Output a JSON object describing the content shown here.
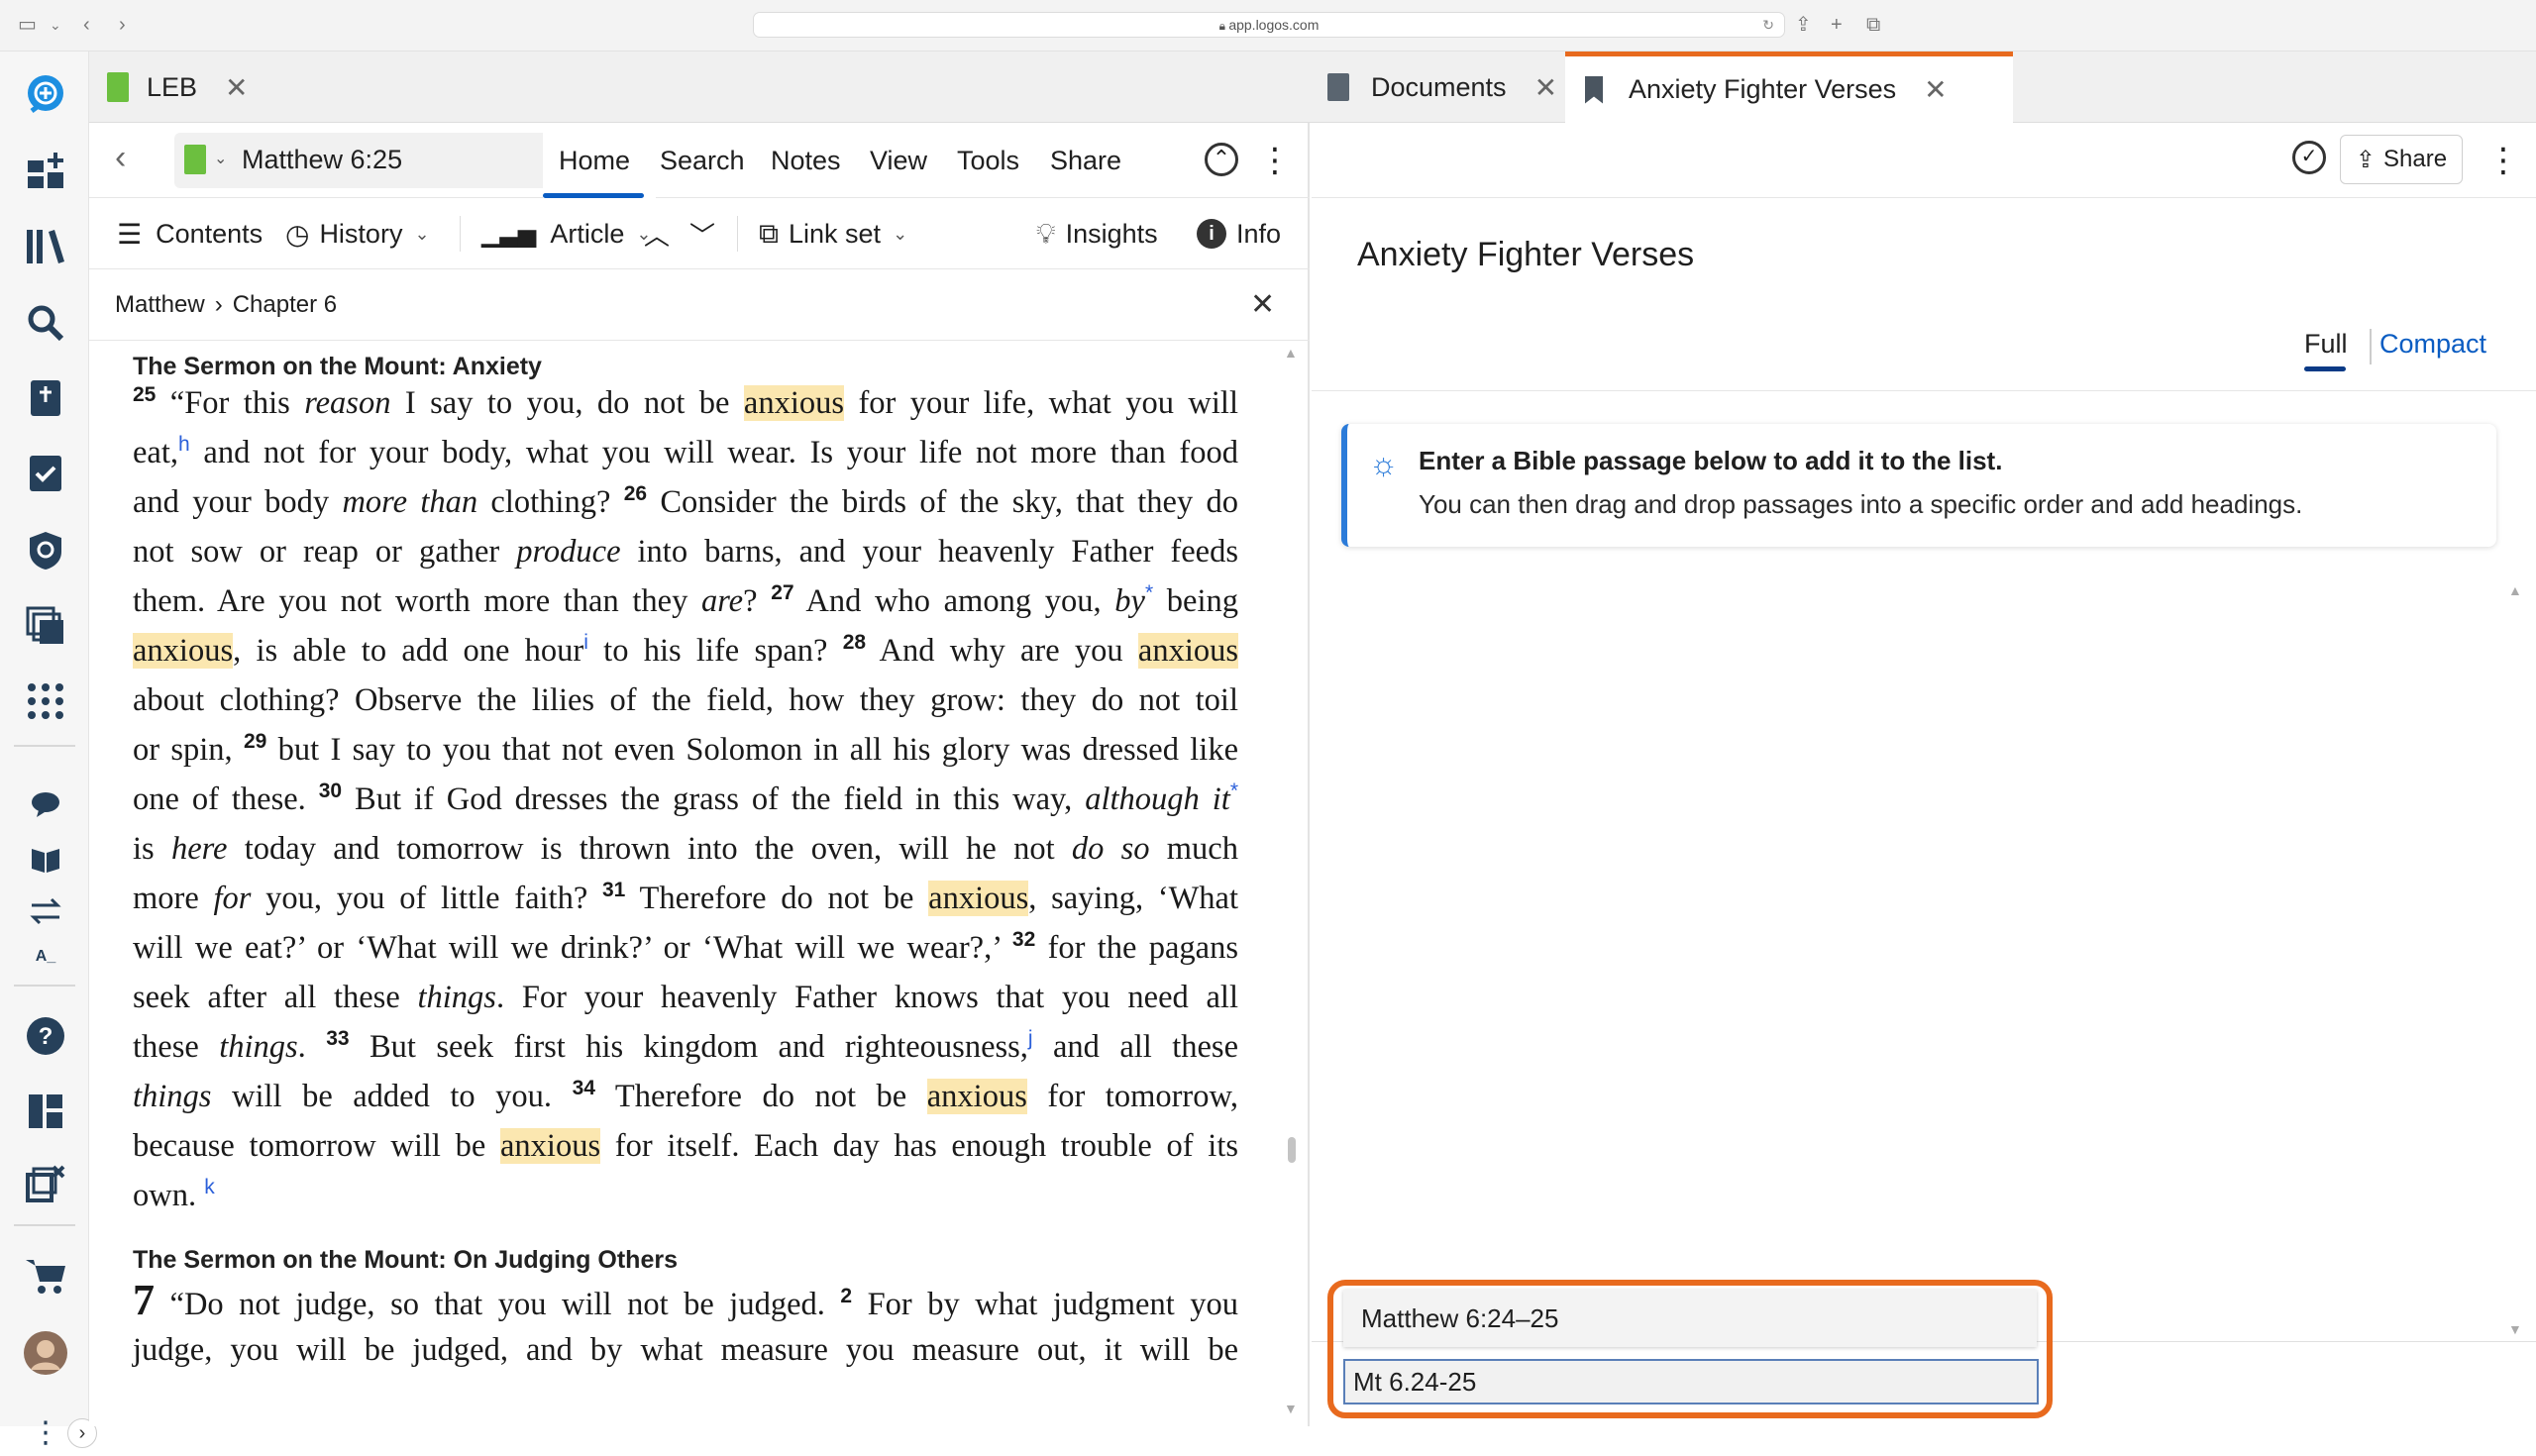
{
  "browser": {
    "url": "app.logos.com"
  },
  "tabs": [
    {
      "label": "LEB",
      "active": true
    },
    {
      "label": "Documents",
      "active": false
    },
    {
      "label": "Anxiety Fighter Verses",
      "active": true
    }
  ],
  "left_panel": {
    "reference": "Matthew 6:25",
    "menu": [
      "Home",
      "Search",
      "Notes",
      "View",
      "Tools",
      "Share"
    ],
    "toolbar": {
      "contents": "Contents",
      "history": "History",
      "article": "Article",
      "link_set": "Link set",
      "insights": "Insights",
      "info": "Info"
    },
    "breadcrumb": {
      "book": "Matthew",
      "sep": "›",
      "chapter": "Chapter 6"
    },
    "heading1": "The Sermon on the Mount: Anxiety",
    "heading2": "The Sermon on the Mount: On Judging Others"
  },
  "right_panel": {
    "title": "Anxiety Fighter Verses",
    "share": "Share",
    "views": {
      "full": "Full",
      "compact": "Compact"
    },
    "tip": {
      "bold": "Enter a Bible passage below to add it to the list.",
      "text": "You can then drag and drop passages into a specific order and add headings."
    },
    "suggestion": "Matthew 6:24–25",
    "input_value": "Mt 6.24-25"
  },
  "colors": {
    "accent": "#0a5cc2",
    "tab_underline": "#e86a1e",
    "highlight": "#fbe7b0",
    "callout": "#e86a1e",
    "logo_green": "#6cbf3f"
  }
}
